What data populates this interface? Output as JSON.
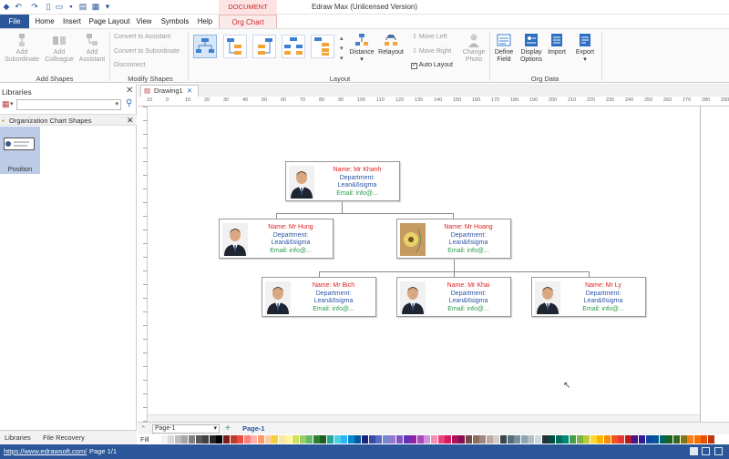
{
  "app": {
    "title": "Edraw Max (Unlicensed Version)",
    "context_group": "DOCUMENT TOO..."
  },
  "tabs": [
    "File",
    "Home",
    "Insert",
    "Page Layout",
    "View",
    "Symbols",
    "Help",
    "Org Chart"
  ],
  "ribbon": {
    "add_shapes": {
      "group_label": "Add Shapes",
      "subordinate": "Add Subordinate",
      "colleague": "Add Colleague",
      "assistant": "Add Assistant"
    },
    "modify_shapes": {
      "group_label": "Modify Shapes",
      "convert_assistant": "Convert to Assistant",
      "convert_subordinate": "Convert to Subordinate",
      "disconnect": "Disconnect"
    },
    "layout": {
      "group_label": "Layout",
      "distance": "Distance",
      "relayout": "Relayout",
      "move_left": "Move Left",
      "move_right": "Move Right",
      "auto_layout": "Auto Layout",
      "auto_layout_checked": true,
      "change_photo": "Change Photo"
    },
    "org_data": {
      "group_label": "Org Data",
      "define_field": "Define Field",
      "display_options": "Display Options",
      "import": "Import",
      "export": "Export"
    }
  },
  "libraries": {
    "title": "Libraries",
    "category": "Organization Chart Shapes",
    "shape_label": "Position",
    "bottom_tabs": [
      "Libraries",
      "File Recovery"
    ]
  },
  "document": {
    "tab": "Drawing1",
    "ruler_ticks": [
      "10",
      "0",
      "10",
      "20",
      "30",
      "40",
      "50",
      "60",
      "70",
      "80",
      "90",
      "100",
      "110",
      "120",
      "130",
      "140",
      "150",
      "160",
      "170",
      "180",
      "190",
      "200",
      "210",
      "220",
      "230",
      "240",
      "250",
      "260",
      "270",
      "280",
      "290"
    ]
  },
  "org_chart": {
    "nodes": [
      {
        "name": "Name: Mr Khanh",
        "department": "Department:",
        "dept_value": "Lean&6sigma",
        "email": "Email: info@..."
      },
      {
        "name": "Name: Mr Hung",
        "department": "Department:",
        "dept_value": "Lean&6sigma",
        "email": "Email: info@..."
      },
      {
        "name": "Name: Mr Hoang",
        "department": "Department:",
        "dept_value": "Lean&6sigma",
        "email": "Email: info@..."
      },
      {
        "name": "Name: Mr Bich",
        "department": "Department:",
        "dept_value": "Lean&6sigma",
        "email": "Email: info@..."
      },
      {
        "name": "Name: Mr Khai",
        "department": "Department:",
        "dept_value": "Lean&6sigma",
        "email": "Email: info@..."
      },
      {
        "name": "Name: Mr Ly",
        "department": "Department:",
        "dept_value": "Lean&6sigma",
        "email": "Email: info@..."
      }
    ]
  },
  "pages": {
    "selector": "Page-1",
    "active_tab": "Page-1"
  },
  "palette_label": "Fill",
  "status": {
    "url": "https://www.edrawsoft.com/",
    "page": "Page 1/1"
  },
  "colors": {
    "accent": "#2b579a",
    "context_tab": "#c4302b",
    "name_text": "#e02020",
    "dept_text": "#2b55a6",
    "email_text": "#2a9a4a"
  }
}
